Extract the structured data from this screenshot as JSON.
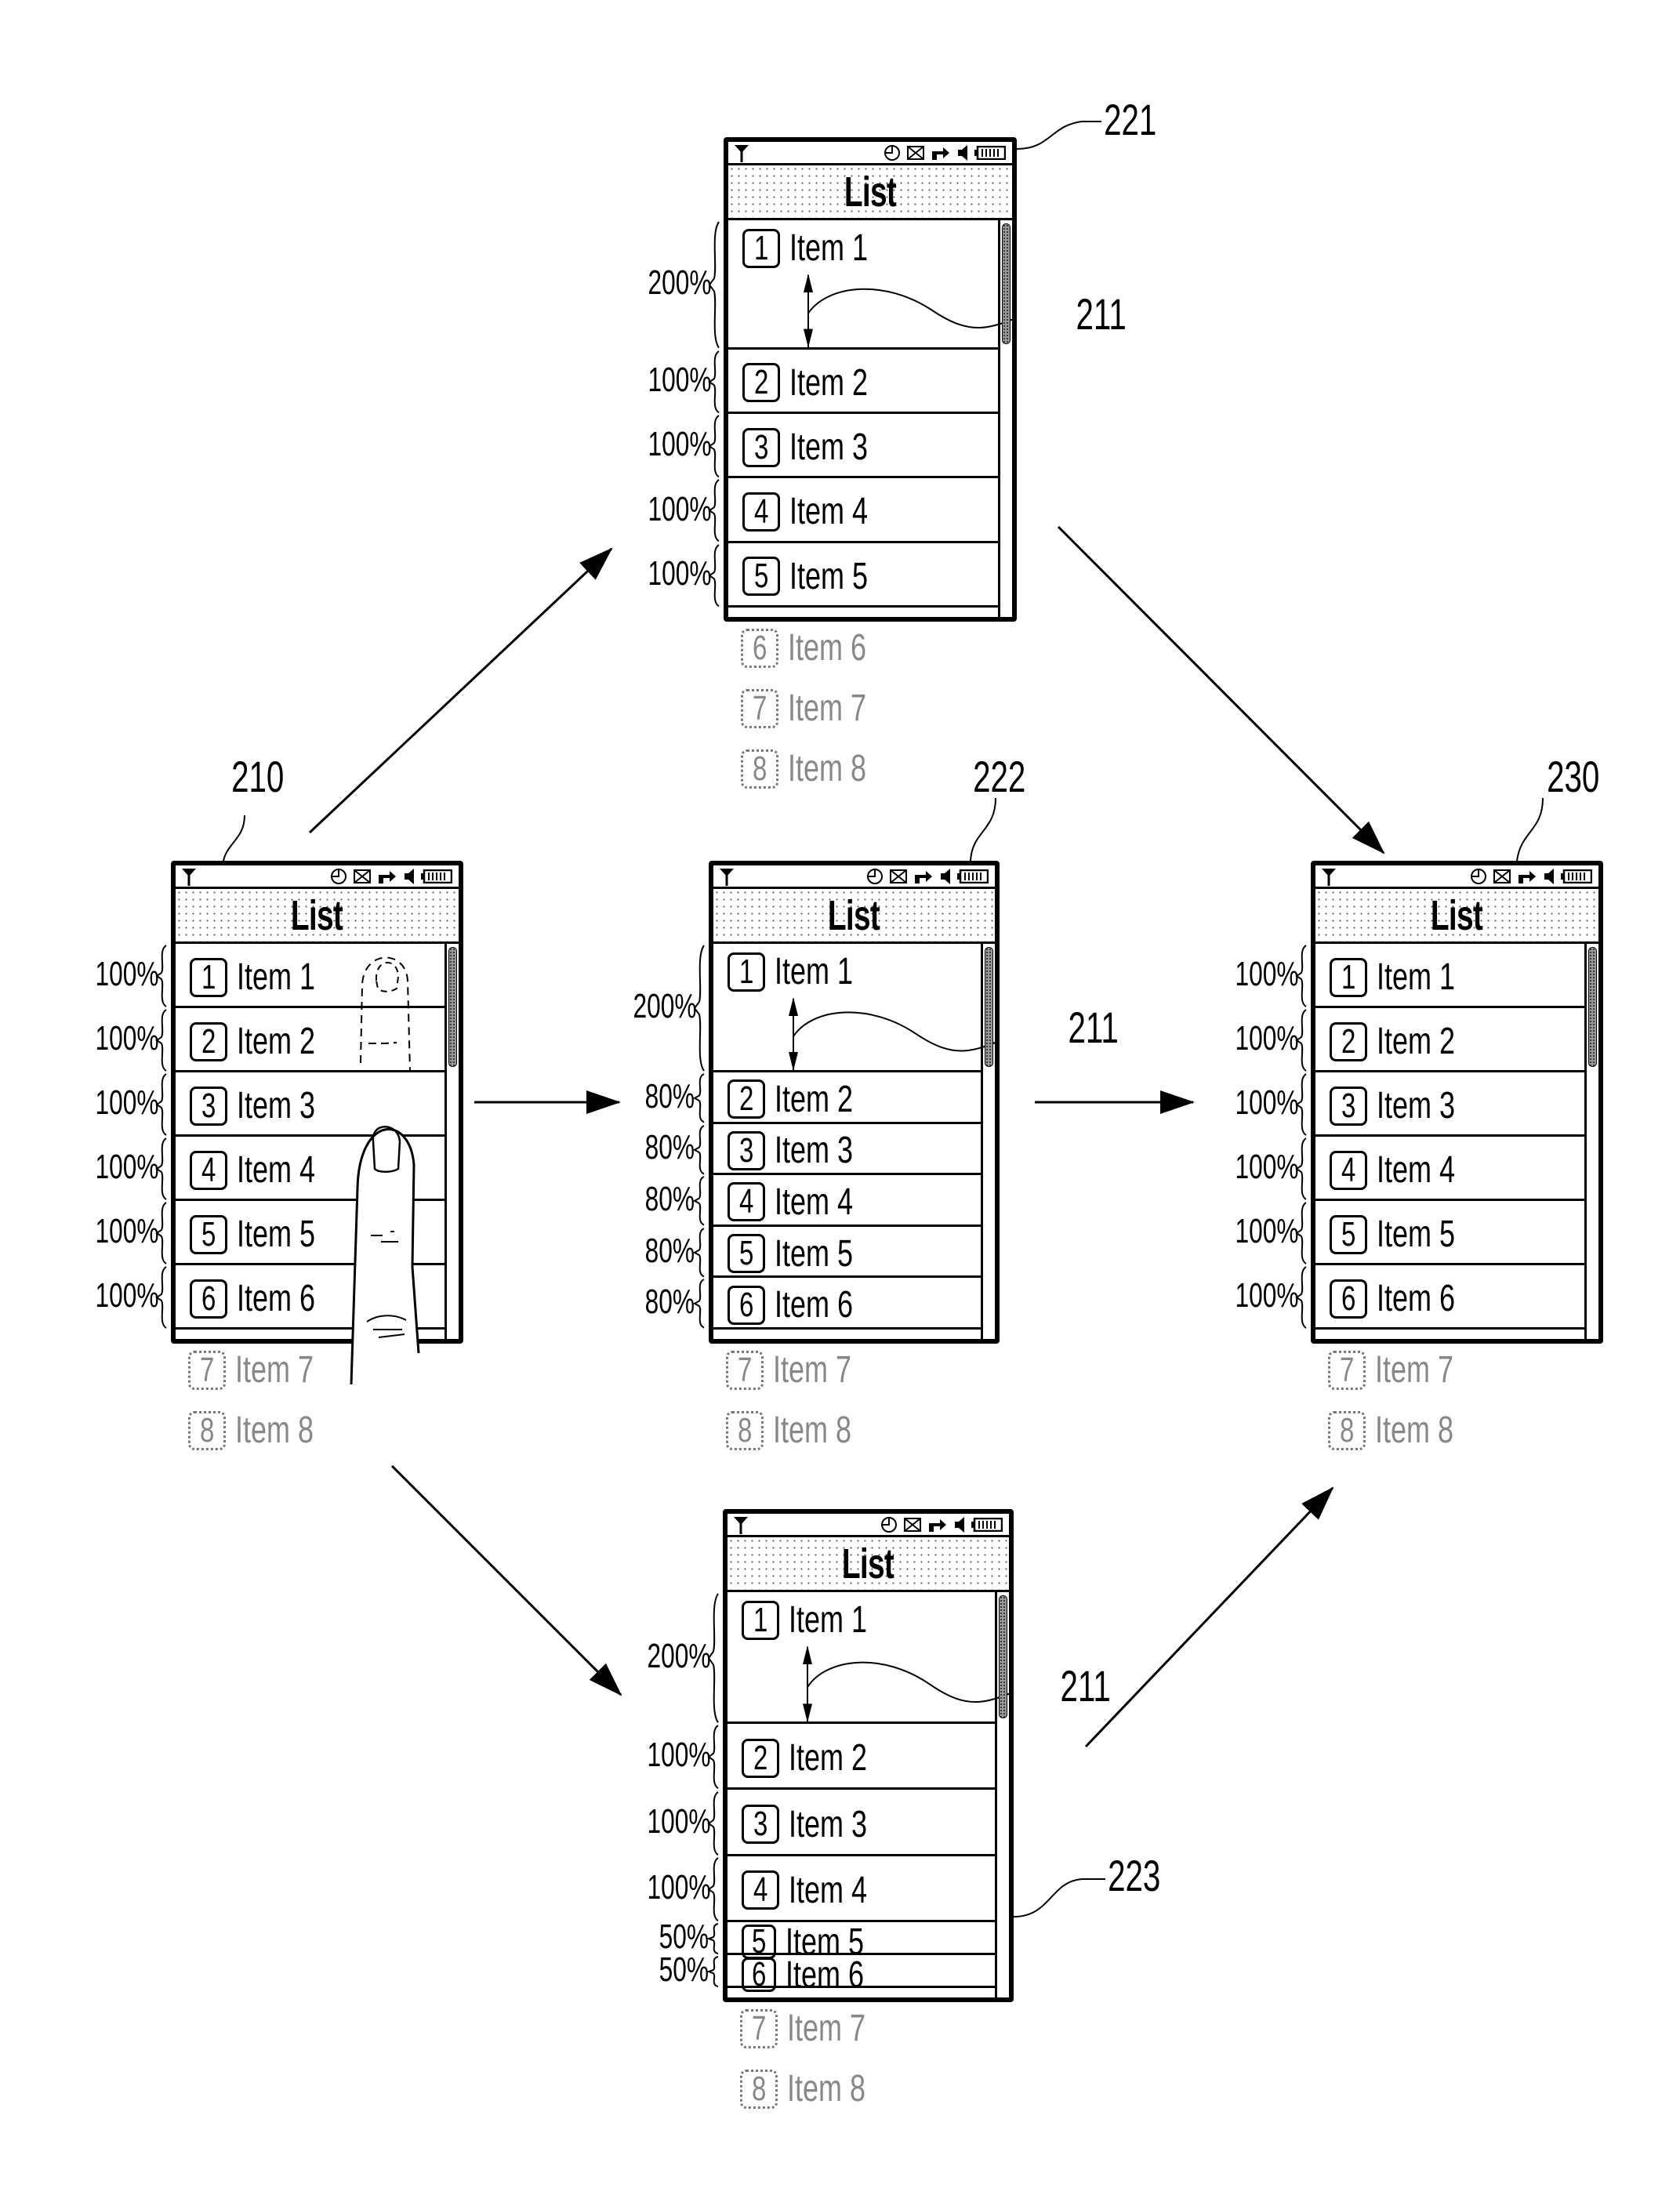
{
  "figure": {
    "reference_labels": {
      "phone_initial": "210",
      "phone_variant_a": "221",
      "phone_variant_b": "222",
      "phone_variant_c": "223",
      "phone_final": "230",
      "expanded_item_ref": "211",
      "shrunk_item_ref": "223"
    }
  },
  "phones": [
    {
      "id": "210",
      "title": "List",
      "status_icons": [
        "antenna-icon",
        "clock-icon",
        "mail-icon",
        "forward-icon",
        "speaker-icon",
        "battery-icon"
      ],
      "rows": [
        {
          "num": "1",
          "label": "Item 1",
          "height_pct": "100%"
        },
        {
          "num": "2",
          "label": "Item 2",
          "height_pct": "100%"
        },
        {
          "num": "3",
          "label": "Item 3",
          "height_pct": "100%"
        },
        {
          "num": "4",
          "label": "Item 4",
          "height_pct": "100%"
        },
        {
          "num": "5",
          "label": "Item 5",
          "height_pct": "100%"
        },
        {
          "num": "6",
          "label": "Item 6",
          "height_pct": "100%"
        }
      ],
      "overflow": [
        {
          "num": "7",
          "label": "Item 7"
        },
        {
          "num": "8",
          "label": "Item 8"
        }
      ],
      "touch_gesture": "finger-drag-down"
    },
    {
      "id": "221",
      "title": "List",
      "rows": [
        {
          "num": "1",
          "label": "Item 1",
          "height_pct": "200%"
        },
        {
          "num": "2",
          "label": "Item 2",
          "height_pct": "100%"
        },
        {
          "num": "3",
          "label": "Item 3",
          "height_pct": "100%"
        },
        {
          "num": "4",
          "label": "Item 4",
          "height_pct": "100%"
        },
        {
          "num": "5",
          "label": "Item 5",
          "height_pct": "100%"
        }
      ],
      "overflow": [
        {
          "num": "6",
          "label": "Item 6"
        },
        {
          "num": "7",
          "label": "Item 7"
        },
        {
          "num": "8",
          "label": "Item 8"
        }
      ]
    },
    {
      "id": "222",
      "title": "List",
      "rows": [
        {
          "num": "1",
          "label": "Item 1",
          "height_pct": "200%"
        },
        {
          "num": "2",
          "label": "Item 2",
          "height_pct": "80%"
        },
        {
          "num": "3",
          "label": "Item 3",
          "height_pct": "80%"
        },
        {
          "num": "4",
          "label": "Item 4",
          "height_pct": "80%"
        },
        {
          "num": "5",
          "label": "Item 5",
          "height_pct": "80%"
        },
        {
          "num": "6",
          "label": "Item 6",
          "height_pct": "80%"
        }
      ],
      "overflow": [
        {
          "num": "7",
          "label": "Item 7"
        },
        {
          "num": "8",
          "label": "Item 8"
        }
      ]
    },
    {
      "id": "223",
      "title": "List",
      "rows": [
        {
          "num": "1",
          "label": "Item 1",
          "height_pct": "200%"
        },
        {
          "num": "2",
          "label": "Item 2",
          "height_pct": "100%"
        },
        {
          "num": "3",
          "label": "Item 3",
          "height_pct": "100%"
        },
        {
          "num": "4",
          "label": "Item 4",
          "height_pct": "100%"
        },
        {
          "num": "5",
          "label": "Item 5",
          "height_pct": "50%"
        },
        {
          "num": "6",
          "label": "Item 6",
          "height_pct": "50%"
        }
      ],
      "overflow": [
        {
          "num": "7",
          "label": "Item 7"
        },
        {
          "num": "8",
          "label": "Item 8"
        }
      ]
    },
    {
      "id": "230",
      "title": "List",
      "rows": [
        {
          "num": "1",
          "label": "Item 1",
          "height_pct": "100%"
        },
        {
          "num": "2",
          "label": "Item 2",
          "height_pct": "100%"
        },
        {
          "num": "3",
          "label": "Item 3",
          "height_pct": "100%"
        },
        {
          "num": "4",
          "label": "Item 4",
          "height_pct": "100%"
        },
        {
          "num": "5",
          "label": "Item 5",
          "height_pct": "100%"
        },
        {
          "num": "6",
          "label": "Item 6",
          "height_pct": "100%"
        }
      ],
      "overflow": [
        {
          "num": "7",
          "label": "Item 7"
        },
        {
          "num": "8",
          "label": "Item 8"
        }
      ]
    }
  ],
  "transitions": [
    {
      "from": "210",
      "to": "221"
    },
    {
      "from": "210",
      "to": "222"
    },
    {
      "from": "210",
      "to": "223"
    },
    {
      "from": "221",
      "to": "230"
    },
    {
      "from": "222",
      "to": "230"
    },
    {
      "from": "223",
      "to": "230"
    }
  ],
  "status_glyphs": {
    "antenna": "Y",
    "clock": "◴",
    "mail": "⊠",
    "forward": "➦",
    "speaker": "◀",
    "battery": "▭"
  }
}
